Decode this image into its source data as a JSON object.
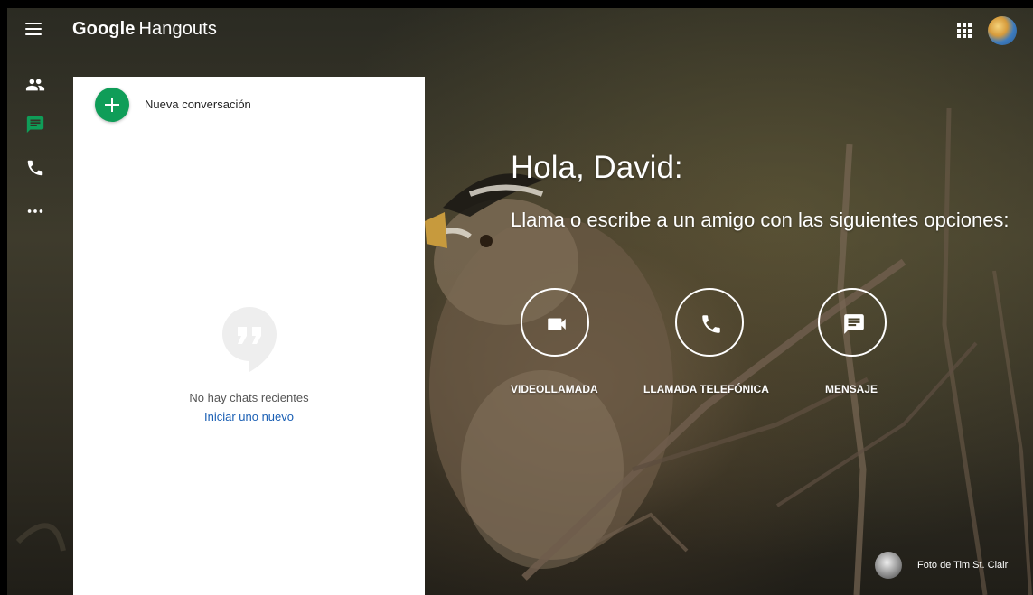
{
  "header": {
    "app_brand": "Google",
    "app_name": "Hangouts"
  },
  "rail": {
    "items": [
      {
        "icon": "contacts-icon",
        "active": false
      },
      {
        "icon": "chat-icon",
        "active": true
      },
      {
        "icon": "phone-icon",
        "active": false
      },
      {
        "icon": "more-icon",
        "active": false
      }
    ]
  },
  "panel": {
    "new_conversation_label": "Nueva conversación",
    "empty_text": "No hay chats recientes",
    "empty_link": "Iniciar uno nuevo"
  },
  "main": {
    "greeting": "Hola, David:",
    "subtitle": "Llama o escribe a un amigo con las siguientes opciones:",
    "actions": [
      {
        "label": "VIDEOLLAMADA",
        "icon": "video-icon"
      },
      {
        "label": "LLAMADA TELEFÓNICA",
        "icon": "phone-icon"
      },
      {
        "label": "MENSAJE",
        "icon": "message-icon"
      }
    ],
    "photo_credit": "Foto de Tim St. Clair"
  },
  "colors": {
    "accent_green": "#0f9d58",
    "link_blue": "#1a5fb4",
    "panel_bg": "#ffffff"
  }
}
